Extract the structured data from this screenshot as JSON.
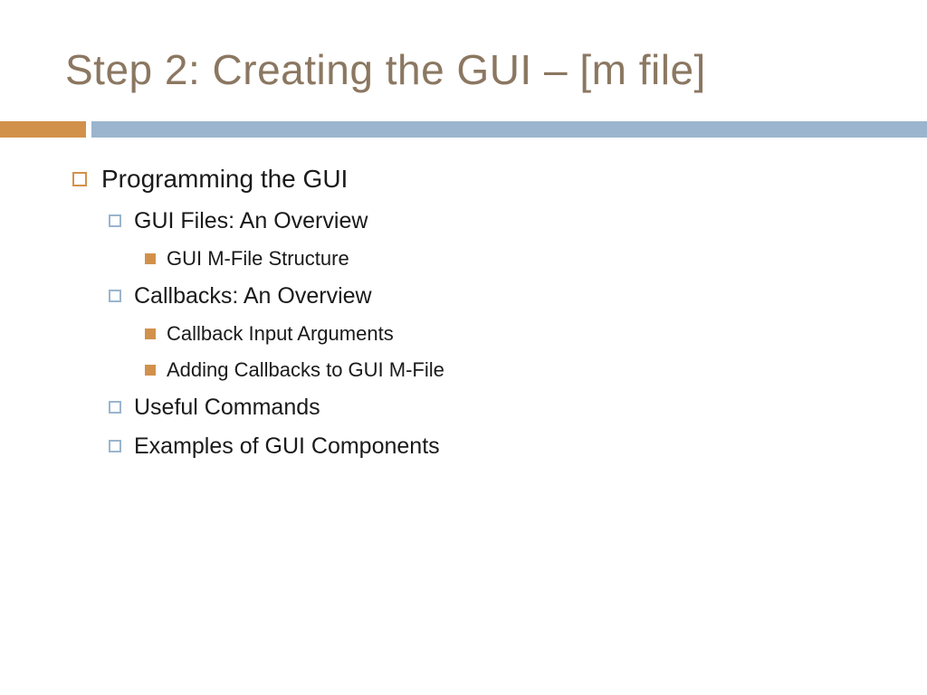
{
  "title": "Step 2: Creating the GUI – [m file]",
  "content": {
    "l1": "Programming the GUI",
    "l2a": "GUI Files: An Overview",
    "l3a": "GUI M-File Structure",
    "l2b": "Callbacks: An Overview",
    "l3b": "Callback Input Arguments",
    "l3c": "Adding Callbacks to GUI M-File",
    "l2c": "Useful Commands",
    "l2d": "Examples of GUI Components"
  }
}
